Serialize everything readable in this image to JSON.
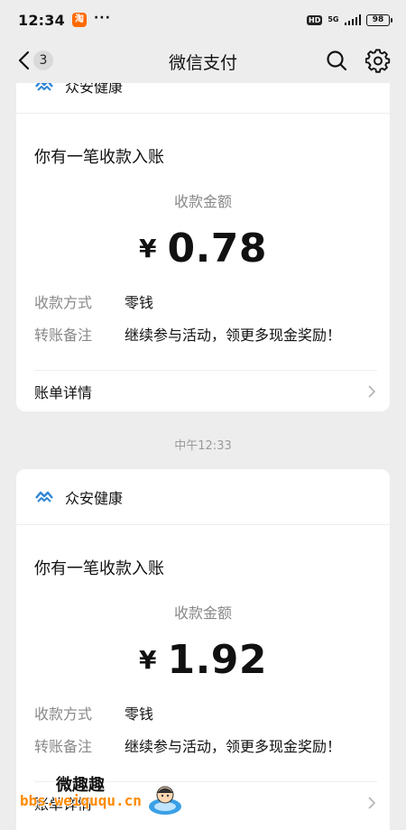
{
  "status_bar": {
    "time": "12:34",
    "app_badge": "淘",
    "dots": "···",
    "hd": "HD",
    "network": "5G",
    "battery": "98"
  },
  "nav": {
    "title": "微信支付",
    "unread_count": "3"
  },
  "cards": [
    {
      "brand": "众安健康",
      "message_title": "你有一笔收款入账",
      "amount_label": "收款金额",
      "currency": "¥",
      "amount": "0.78",
      "details": [
        {
          "key": "收款方式",
          "value": "零钱"
        },
        {
          "key": "转账备注",
          "value": "继续参与活动，领更多现金奖励！"
        }
      ],
      "bill_label": "账单详情"
    },
    {
      "brand": "众安健康",
      "message_title": "你有一笔收款入账",
      "amount_label": "收款金额",
      "currency": "¥",
      "amount": "1.92",
      "details": [
        {
          "key": "收款方式",
          "value": "零钱"
        },
        {
          "key": "转账备注",
          "value": "继续参与活动，领更多现金奖励！"
        }
      ],
      "bill_label": "账单详情"
    }
  ],
  "timestamp": "中午12:33",
  "watermark": {
    "title": "微趣趣",
    "url": "bbs.weiququ.cn"
  },
  "colors": {
    "background": "#ededed",
    "card": "#ffffff",
    "secondary_text": "#888888",
    "logo_blue": "#2f86d6"
  }
}
